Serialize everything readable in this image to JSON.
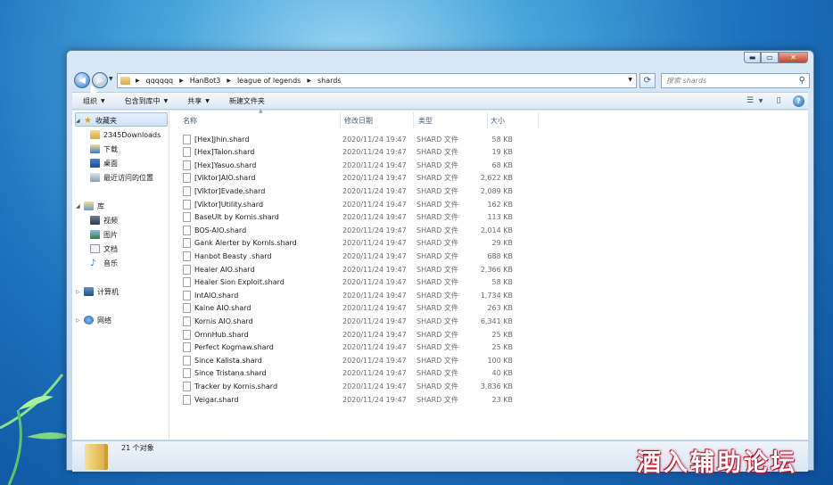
{
  "breadcrumb": [
    "qqqqqq",
    "HanBot3",
    "league of legends",
    "shards"
  ],
  "search": {
    "placeholder": "搜索 shards"
  },
  "toolbar": {
    "organize": "组织",
    "include_in_library": "包含到库中",
    "share": "共享",
    "new_folder": "新建文件夹"
  },
  "sidebar": {
    "favorites": "收藏夹",
    "favorites_items": [
      "2345Downloads",
      "下载",
      "桌面",
      "最近访问的位置"
    ],
    "libraries": "库",
    "libraries_items": [
      "视频",
      "图片",
      "文档",
      "音乐"
    ],
    "computer": "计算机",
    "network": "网络"
  },
  "columns": {
    "name": "名称",
    "date": "修改日期",
    "type": "类型",
    "size": "大小"
  },
  "files": [
    {
      "name": "[Hex]Jhin.shard",
      "date": "2020/11/24 19:47",
      "type": "SHARD 文件",
      "size": "58 KB"
    },
    {
      "name": "[Hex]Talon.shard",
      "date": "2020/11/24 19:47",
      "type": "SHARD 文件",
      "size": "19 KB"
    },
    {
      "name": "[Hex]Yasuo.shard",
      "date": "2020/11/24 19:47",
      "type": "SHARD 文件",
      "size": "68 KB"
    },
    {
      "name": "[Viktor]AIO.shard",
      "date": "2020/11/24 19:47",
      "type": "SHARD 文件",
      "size": "2,622 KB"
    },
    {
      "name": "[Viktor]Evade.shard",
      "date": "2020/11/24 19:47",
      "type": "SHARD 文件",
      "size": "2,089 KB"
    },
    {
      "name": "[Viktor]Utility.shard",
      "date": "2020/11/24 19:47",
      "type": "SHARD 文件",
      "size": "162 KB"
    },
    {
      "name": "BaseUlt by Kornis.shard",
      "date": "2020/11/24 19:47",
      "type": "SHARD 文件",
      "size": "113 KB"
    },
    {
      "name": "BOS-AIO.shard",
      "date": "2020/11/24 19:47",
      "type": "SHARD 文件",
      "size": "2,014 KB"
    },
    {
      "name": "Gank Alerter by Kornis.shard",
      "date": "2020/11/24 19:47",
      "type": "SHARD 文件",
      "size": "29 KB"
    },
    {
      "name": "Hanbot Beasty .shard",
      "date": "2020/11/24 19:47",
      "type": "SHARD 文件",
      "size": "688 KB"
    },
    {
      "name": "Healer AIO.shard",
      "date": "2020/11/24 19:47",
      "type": "SHARD 文件",
      "size": "2,366 KB"
    },
    {
      "name": "Healer Sion Exploit.shard",
      "date": "2020/11/24 19:47",
      "type": "SHARD 文件",
      "size": "58 KB"
    },
    {
      "name": "IntAIO.shard",
      "date": "2020/11/24 19:47",
      "type": "SHARD 文件",
      "size": "1,734 KB"
    },
    {
      "name": "Kaine AIO.shard",
      "date": "2020/11/24 19:47",
      "type": "SHARD 文件",
      "size": "263 KB"
    },
    {
      "name": "Kornis AIO.shard",
      "date": "2020/11/24 19:47",
      "type": "SHARD 文件",
      "size": "6,341 KB"
    },
    {
      "name": "OrnnHub.shard",
      "date": "2020/11/24 19:47",
      "type": "SHARD 文件",
      "size": "25 KB"
    },
    {
      "name": "Perfect Kogmaw.shard",
      "date": "2020/11/24 19:47",
      "type": "SHARD 文件",
      "size": "25 KB"
    },
    {
      "name": "Since Kalista.shard",
      "date": "2020/11/24 19:47",
      "type": "SHARD 文件",
      "size": "100 KB"
    },
    {
      "name": "Since Tristana.shard",
      "date": "2020/11/24 19:47",
      "type": "SHARD 文件",
      "size": "40 KB"
    },
    {
      "name": "Tracker by Kornis.shard",
      "date": "2020/11/24 19:47",
      "type": "SHARD 文件",
      "size": "3,836 KB"
    },
    {
      "name": "Veigar.shard",
      "date": "2020/11/24 19:47",
      "type": "SHARD 文件",
      "size": "23 KB"
    }
  ],
  "status": {
    "item_count": "21 个对象"
  },
  "watermark": "酒入辅助论坛",
  "icons": {
    "back": "back-arrow-icon",
    "forward": "forward-arrow-icon",
    "refresh": "refresh-icon",
    "search": "search-icon",
    "view": "view-options-icon",
    "preview": "preview-pane-icon",
    "help": "help-icon"
  }
}
